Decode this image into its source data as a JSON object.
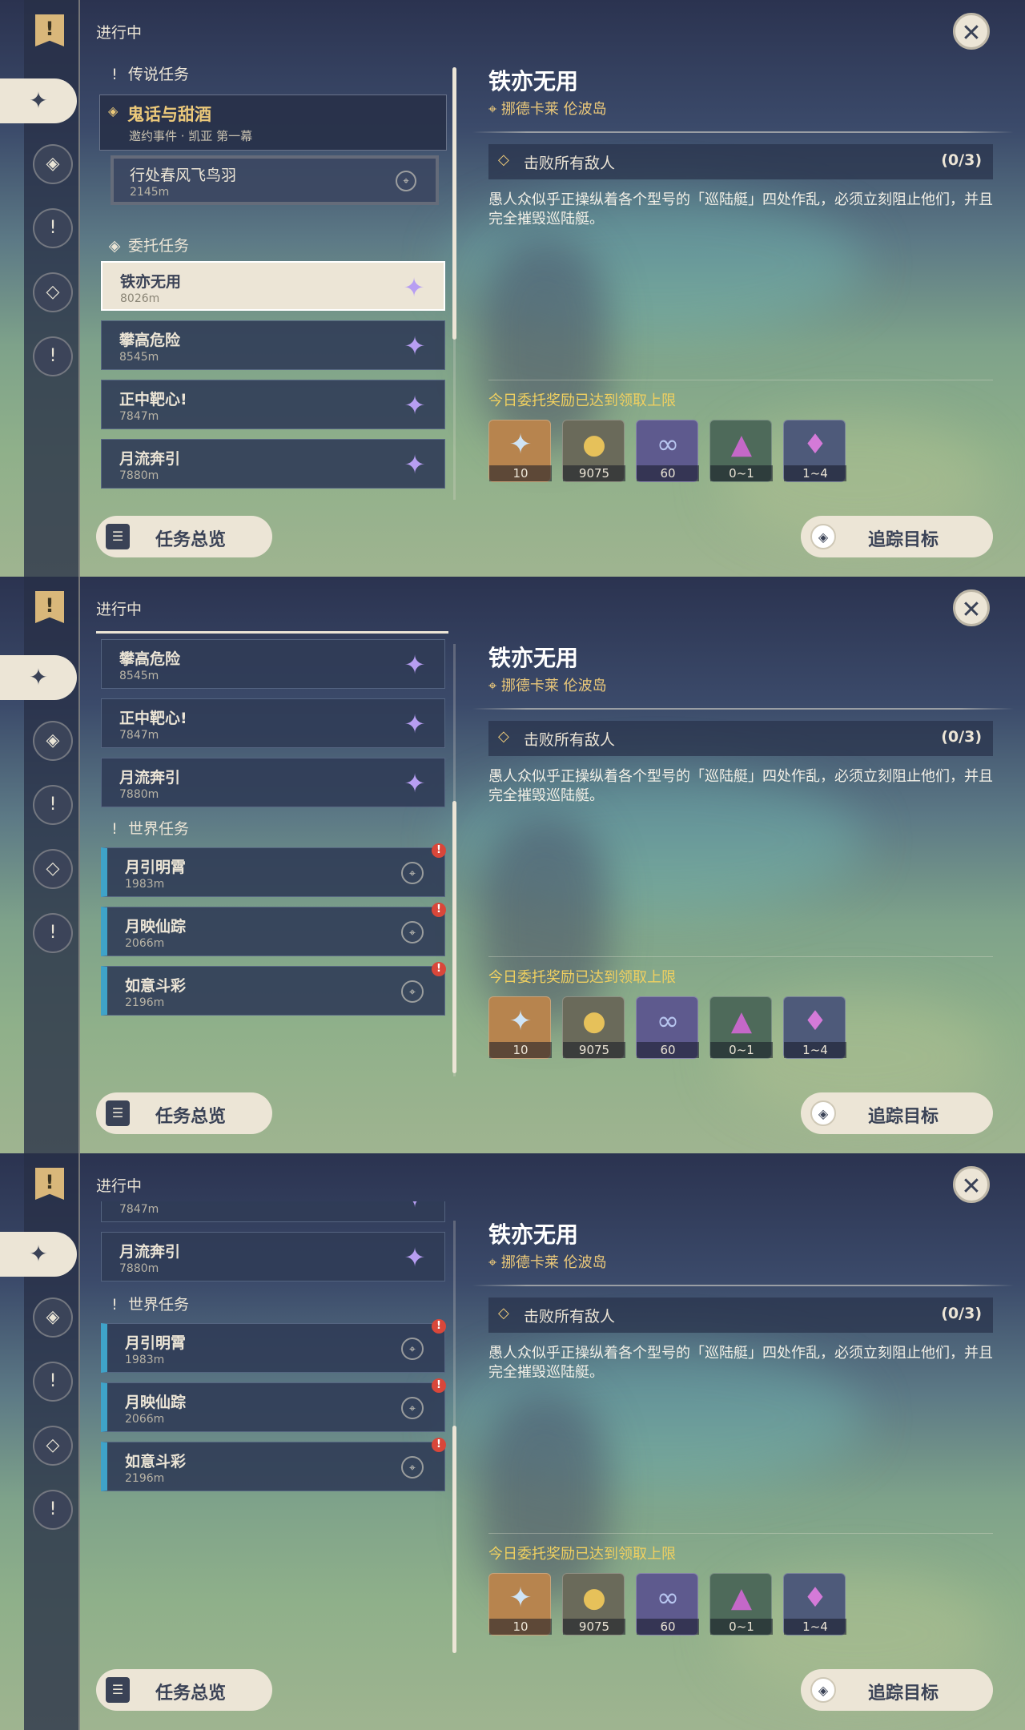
{
  "ui": {
    "status": "进行中",
    "legend_section": "传说任务",
    "commission_section": "委托任务",
    "world_section": "世界任务",
    "overview_label": "任务总览",
    "track_label": "追踪目标"
  },
  "legend_quest": {
    "title": "鬼话与甜酒",
    "subtitle": "邀约事件 · 凯亚 第一幕",
    "sub_title": "行处春风飞鸟羽",
    "sub_distance": "2145m"
  },
  "commissions": [
    {
      "title": "铁亦无用",
      "distance": "8026m"
    },
    {
      "title": "攀高危险",
      "distance": "8545m"
    },
    {
      "title": "正中靶心!",
      "distance": "7847m"
    },
    {
      "title": "月流奔引",
      "distance": "7880m"
    }
  ],
  "world_quests": [
    {
      "title": "月引明霄",
      "distance": "1983m"
    },
    {
      "title": "月映仙踪",
      "distance": "2066m"
    },
    {
      "title": "如意斗彩",
      "distance": "2196m"
    }
  ],
  "detail": {
    "title": "铁亦无用",
    "location": "挪德卡莱 伦波岛",
    "objective": "击败所有敌人",
    "progress": "(0/3)",
    "description": "愚人众似乎正操纵着各个型号的「巡陆艇」四处作乱，必须立刻阻止他们，并且完全摧毁巡陆艇。",
    "reward_limit": "今日委托奖励已达到领取上限",
    "rewards": [
      {
        "icon": "primogem-icon",
        "qty": "10",
        "color": "#b7844e"
      },
      {
        "icon": "mora-icon",
        "qty": "9075",
        "color": "#6a6a5a"
      },
      {
        "icon": "fetters-icon",
        "qty": "60",
        "color": "#5e5a8e"
      },
      {
        "icon": "crystal-icon",
        "qty": "0~1",
        "color": "#4e6a5a"
      },
      {
        "icon": "crystal-cluster-icon",
        "qty": "1~4",
        "color": "#4e5a7a"
      }
    ]
  }
}
